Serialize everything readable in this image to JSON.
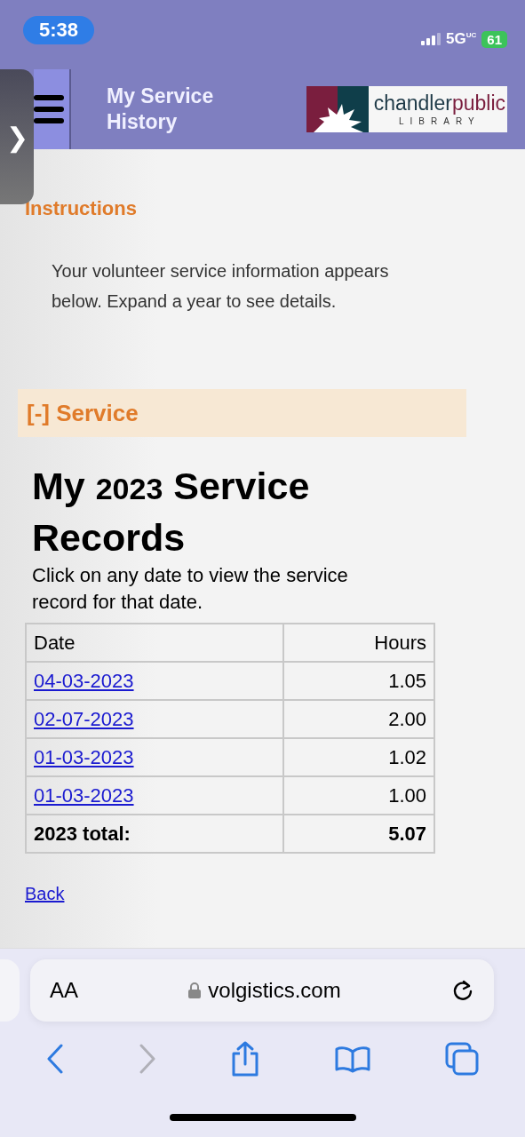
{
  "status_bar": {
    "time": "5:38",
    "network": "5G",
    "network_sup": "UC",
    "battery": "61"
  },
  "header": {
    "title": "My Service History",
    "logo": {
      "name_part1": "chandler",
      "name_part2": "public",
      "subtitle": "LIBRARY"
    }
  },
  "side_tab": {
    "glyph": "❯"
  },
  "instructions": {
    "heading": "Instructions",
    "text": "Your volunteer service information appears below. Expand a year to see details."
  },
  "service_section": {
    "toggle": "[-]",
    "label": "Service",
    "expanded": true
  },
  "records": {
    "title_before": "My",
    "year": "2023",
    "title_after": "Service Records",
    "hint": "Click on any date to view the service record for that date.",
    "columns": [
      "Date",
      "Hours"
    ],
    "rows": [
      {
        "date": "04-03-2023",
        "hours": "1.05"
      },
      {
        "date": "02-07-2023",
        "hours": "2.00"
      },
      {
        "date": "01-03-2023",
        "hours": "1.02"
      },
      {
        "date": "01-03-2023",
        "hours": "1.00"
      }
    ],
    "total": {
      "label": "2023 total:",
      "hours": "5.07"
    }
  },
  "back_link": "Back",
  "browser": {
    "text_size": "AA",
    "url": "volgistics.com",
    "nav": [
      {
        "kind": "back",
        "disabled": false
      },
      {
        "kind": "forward",
        "disabled": true
      },
      {
        "kind": "share",
        "disabled": false
      },
      {
        "kind": "bookmarks",
        "disabled": false
      },
      {
        "kind": "tabs",
        "disabled": false
      }
    ]
  }
}
